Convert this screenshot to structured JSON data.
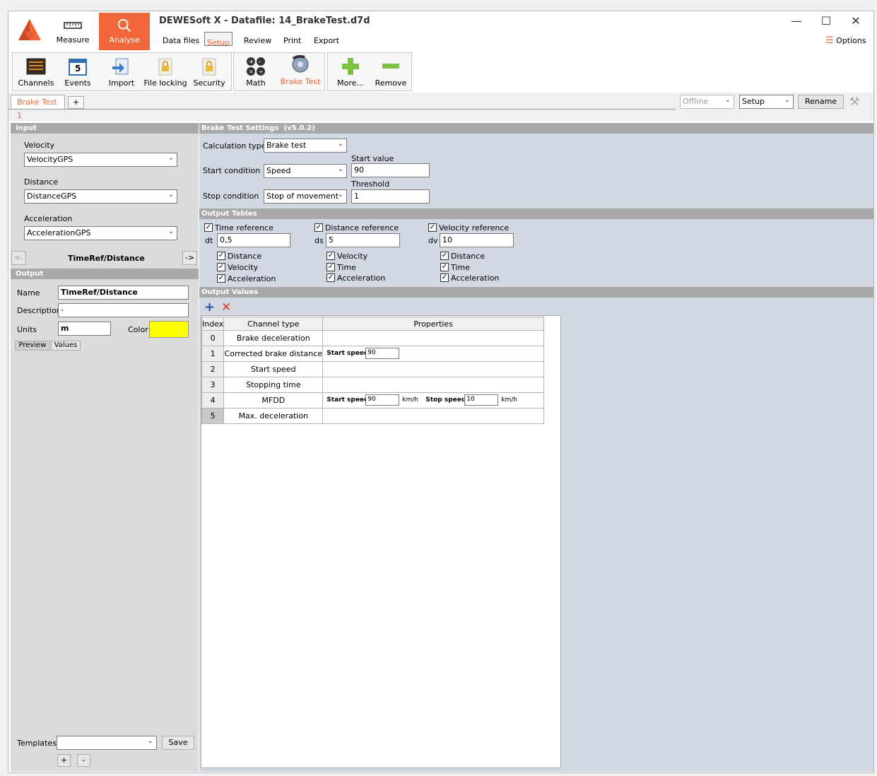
{
  "app": {
    "title": "DEWESoft X - Datafile: 14_BrakeTest.d7d",
    "options_label": "Options"
  },
  "modes": {
    "measure": "Measure",
    "analyse": "Analyse"
  },
  "menu": {
    "data_files": "Data files",
    "setup": "Setup",
    "review": "Review",
    "print": "Print",
    "export": "Export"
  },
  "toolbar": {
    "channels": "Channels",
    "events": "Events",
    "import": "Import",
    "file_locking": "File locking",
    "security": "Security",
    "math": "Math",
    "brake_test": "Brake Test",
    "more": "More...",
    "remove": "Remove",
    "events_badge": "5"
  },
  "tabs": {
    "active": "Brake Test 1",
    "add": "+"
  },
  "top_right": {
    "mode_value": "Offline",
    "view_value": "Setup",
    "rename": "Rename"
  },
  "input": {
    "header": "Input",
    "velocity_label": "Velocity",
    "velocity_value": "VelocityGPS",
    "distance_label": "Distance",
    "distance_value": "DistanceGPS",
    "acceleration_label": "Acceleration",
    "acceleration_value": "AccelerationGPS",
    "nav_prev": "<-",
    "nav_title": "TimeRef/Distance",
    "nav_next": "->"
  },
  "output": {
    "header": "Output",
    "name_label": "Name",
    "name_value": "TimeRef/Distance",
    "desc_label": "Description",
    "desc_value": "-",
    "units_label": "Units",
    "units_value": "m",
    "color_label": "Color",
    "color_hex": "#ffff00",
    "preview": "Preview",
    "values": "Values"
  },
  "templates": {
    "label": "Templates",
    "value": "",
    "save": "Save",
    "plus": "+",
    "minus": "-"
  },
  "settings": {
    "header": "Brake Test Settings",
    "version": "(v5.0.2)",
    "calc_label": "Calculation type",
    "calc_value": "Brake test",
    "start_cond_label": "Start condition",
    "start_cond_value": "Speed",
    "start_value_label": "Start value",
    "start_value": "90",
    "stop_cond_label": "Stop condition",
    "stop_cond_value": "Stop of movement",
    "threshold_label": "Threshold",
    "threshold": "1"
  },
  "output_tables": {
    "header": "Output Tables",
    "time": {
      "label": "Time reference",
      "short": "dt",
      "value": "0,5",
      "items": [
        "Distance",
        "Velocity",
        "Acceleration"
      ]
    },
    "distance": {
      "label": "Distance reference",
      "short": "ds",
      "value": "5",
      "items": [
        "Velocity",
        "Time",
        "Acceleration"
      ]
    },
    "velocity": {
      "label": "Velocity reference",
      "short": "dv",
      "value": "10",
      "items": [
        "Distance",
        "Time",
        "Acceleration"
      ]
    }
  },
  "output_values": {
    "header": "Output Values",
    "col_index": "Index",
    "col_type": "Channel type",
    "col_props": "Properties",
    "rows": [
      {
        "index": "0",
        "type": "Brake deceleration"
      },
      {
        "index": "1",
        "type": "Corrected brake distance"
      },
      {
        "index": "2",
        "type": "Start speed"
      },
      {
        "index": "3",
        "type": "Stopping time"
      },
      {
        "index": "4",
        "type": "MFDD"
      },
      {
        "index": "5",
        "type": "Max. deceleration"
      }
    ],
    "start_speed_label": "Start speed",
    "start_speed": "90",
    "stop_speed_label": "Stop speed",
    "stop_speed": "10",
    "unit": "km/h"
  }
}
